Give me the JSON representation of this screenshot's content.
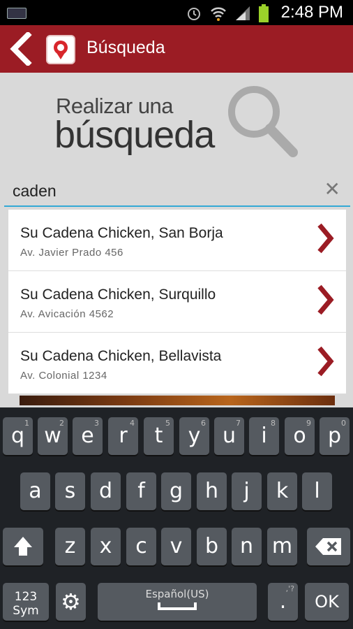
{
  "status_bar": {
    "time": "2:48 PM"
  },
  "app_bar": {
    "title": "Búsqueda"
  },
  "hero": {
    "line1": "Realizar una",
    "line2": "búsqueda"
  },
  "search": {
    "value": "caden"
  },
  "results": [
    {
      "name": "Su Cadena Chicken, San Borja",
      "address": "Av. Javier Prado 456"
    },
    {
      "name": "Su Cadena Chicken, Surquillo",
      "address": "Av. Avicación 4562"
    },
    {
      "name": "Su Cadena Chicken, Bellavista",
      "address": "Av. Colonial 1234"
    }
  ],
  "keyboard": {
    "row1": [
      "q",
      "w",
      "e",
      "r",
      "t",
      "y",
      "u",
      "i",
      "o",
      "p"
    ],
    "row1_hints": [
      "1",
      "2",
      "3",
      "4",
      "5",
      "6",
      "7",
      "8",
      "9",
      "0"
    ],
    "row2": [
      "a",
      "s",
      "d",
      "f",
      "g",
      "h",
      "j",
      "k",
      "l"
    ],
    "row3": [
      "z",
      "x",
      "c",
      "v",
      "b",
      "n",
      "m"
    ],
    "sym_line1": "123",
    "sym_line2": "Sym",
    "space_label": "Español(US)",
    "punct_label": ".",
    "punct_hint": ",'?",
    "ok_label": "OK"
  },
  "colors": {
    "app_bar": "#9b1c24",
    "accent": "#33a9d6",
    "chevron": "#9b1c24"
  }
}
